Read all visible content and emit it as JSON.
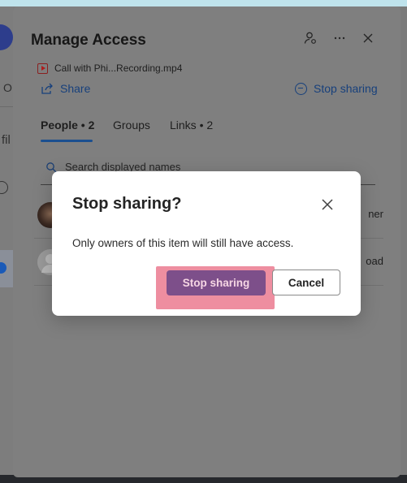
{
  "background": {
    "left_text_1": "O",
    "left_text_2": "fil"
  },
  "panel": {
    "title": "Manage Access",
    "file_name": "Call with Phi...Recording.mp4",
    "share_label": "Share",
    "stop_sharing_label": "Stop sharing",
    "tabs": [
      {
        "label": "People • 2"
      },
      {
        "label": "Groups"
      },
      {
        "label": "Links • 2"
      }
    ],
    "search_placeholder": "Search displayed names",
    "people": [
      {
        "role": "ner"
      },
      {
        "role": "oad"
      }
    ]
  },
  "dialog": {
    "title": "Stop sharing?",
    "message": "Only owners of this item will still have access.",
    "confirm_label": "Stop sharing",
    "cancel_label": "Cancel"
  },
  "colors": {
    "primary_button": "#7d4f8a",
    "highlight": "#ee8ea0",
    "link": "#17407c"
  }
}
